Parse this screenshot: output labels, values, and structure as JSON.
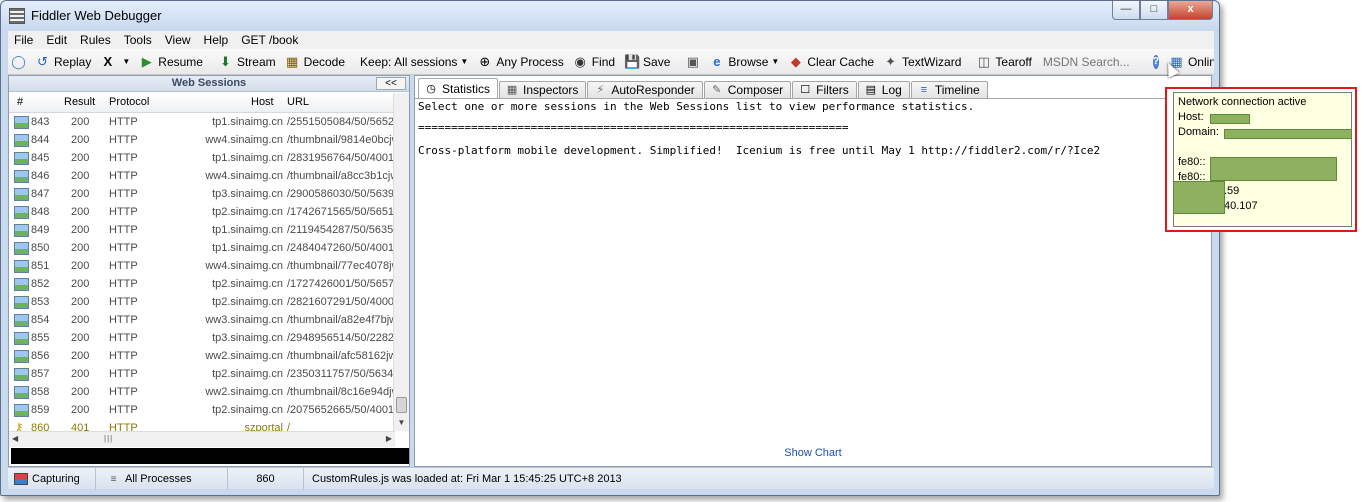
{
  "window": {
    "title": "Fiddler Web Debugger",
    "controls": {
      "minimize": "—",
      "maximize": "□",
      "close": "x"
    }
  },
  "menu": [
    "File",
    "Edit",
    "Rules",
    "Tools",
    "View",
    "Help",
    "GET /book"
  ],
  "toolbar": {
    "replay": "Replay",
    "x_menu": "X",
    "resume": "Resume",
    "stream": "Stream",
    "decode": "Decode",
    "keep": "Keep: All sessions",
    "any_process": "Any Process",
    "find": "Find",
    "save": "Save",
    "browse": "Browse",
    "clear_cache": "Clear Cache",
    "textwizard": "TextWizard",
    "tearoff": "Tearoff",
    "msdn_placeholder": "MSDN Search...",
    "help": "?",
    "online": "Online",
    "close_x": "x"
  },
  "web_sessions": {
    "title": "Web Sessions",
    "collapse": "<<",
    "columns": {
      "num": "#",
      "result": "Result",
      "protocol": "Protocol",
      "host": "Host",
      "url": "URL"
    },
    "rows": [
      {
        "num": "843",
        "result": "200",
        "protocol": "HTTP",
        "host": "tp1.sinaimg.cn",
        "url": "/2551505084/50/5652"
      },
      {
        "num": "844",
        "result": "200",
        "protocol": "HTTP",
        "host": "ww4.sinaimg.cn",
        "url": "/thumbnail/9814e0bcjw"
      },
      {
        "num": "845",
        "result": "200",
        "protocol": "HTTP",
        "host": "tp1.sinaimg.cn",
        "url": "/2831956764/50/4001"
      },
      {
        "num": "846",
        "result": "200",
        "protocol": "HTTP",
        "host": "ww4.sinaimg.cn",
        "url": "/thumbnail/a8cc3b1cjw"
      },
      {
        "num": "847",
        "result": "200",
        "protocol": "HTTP",
        "host": "tp3.sinaimg.cn",
        "url": "/2900586030/50/5639"
      },
      {
        "num": "848",
        "result": "200",
        "protocol": "HTTP",
        "host": "tp2.sinaimg.cn",
        "url": "/1742671565/50/5651"
      },
      {
        "num": "849",
        "result": "200",
        "protocol": "HTTP",
        "host": "tp1.sinaimg.cn",
        "url": "/2119454287/50/5635"
      },
      {
        "num": "850",
        "result": "200",
        "protocol": "HTTP",
        "host": "tp1.sinaimg.cn",
        "url": "/2484047260/50/4001"
      },
      {
        "num": "851",
        "result": "200",
        "protocol": "HTTP",
        "host": "ww4.sinaimg.cn",
        "url": "/thumbnail/77ec4078jw"
      },
      {
        "num": "852",
        "result": "200",
        "protocol": "HTTP",
        "host": "tp2.sinaimg.cn",
        "url": "/1727426001/50/5657"
      },
      {
        "num": "853",
        "result": "200",
        "protocol": "HTTP",
        "host": "tp2.sinaimg.cn",
        "url": "/2821607291/50/4000"
      },
      {
        "num": "854",
        "result": "200",
        "protocol": "HTTP",
        "host": "ww3.sinaimg.cn",
        "url": "/thumbnail/a82e4f7bjw"
      },
      {
        "num": "855",
        "result": "200",
        "protocol": "HTTP",
        "host": "tp3.sinaimg.cn",
        "url": "/2948956514/50/2282"
      },
      {
        "num": "856",
        "result": "200",
        "protocol": "HTTP",
        "host": "ww2.sinaimg.cn",
        "url": "/thumbnail/afc58162jw"
      },
      {
        "num": "857",
        "result": "200",
        "protocol": "HTTP",
        "host": "tp2.sinaimg.cn",
        "url": "/2350311757/50/5634"
      },
      {
        "num": "858",
        "result": "200",
        "protocol": "HTTP",
        "host": "ww2.sinaimg.cn",
        "url": "/thumbnail/8c16e94djw"
      },
      {
        "num": "859",
        "result": "200",
        "protocol": "HTTP",
        "host": "tp2.sinaimg.cn",
        "url": "/2075652665/50/4001"
      },
      {
        "num": "860",
        "result": "401",
        "protocol": "HTTP",
        "host": "szportal",
        "url": "/",
        "highlight": true
      }
    ]
  },
  "tabs": [
    "Statistics",
    "Inspectors",
    "AutoResponder",
    "Composer",
    "Filters",
    "Log",
    "Timeline"
  ],
  "statistics": {
    "line1": "Select one or more sessions in the Web Sessions list to view performance statistics.",
    "separator": "=================================================================",
    "line3": "Cross-platform mobile development. Simplified!  Icenium is free until May 1 http://fiddler2.com/r/?Ice2",
    "show_chart": "Show Chart"
  },
  "status": {
    "capturing": "Capturing",
    "processes": "All Processes",
    "count": "860",
    "message": "CustomRules.js was loaded at: Fri Mar 1 15:45:25 UTC+8 2013"
  },
  "tooltip": {
    "title": "Network connection active",
    "host_label": "Host:",
    "domain_label": "Domain:",
    "fe80_a": "fe80::",
    "fe80_b": "fe80::",
    "ip1_tail": ".59",
    "ip2_tail": "40.107"
  },
  "colors": {
    "window_frame": "#c9d9ee",
    "highlight_row_text": "#8a7a00",
    "tooltip_border": "#e01818",
    "tooltip_bg": "#ffffe1",
    "redaction": "#8db15e",
    "link": "#1b50b8"
  }
}
